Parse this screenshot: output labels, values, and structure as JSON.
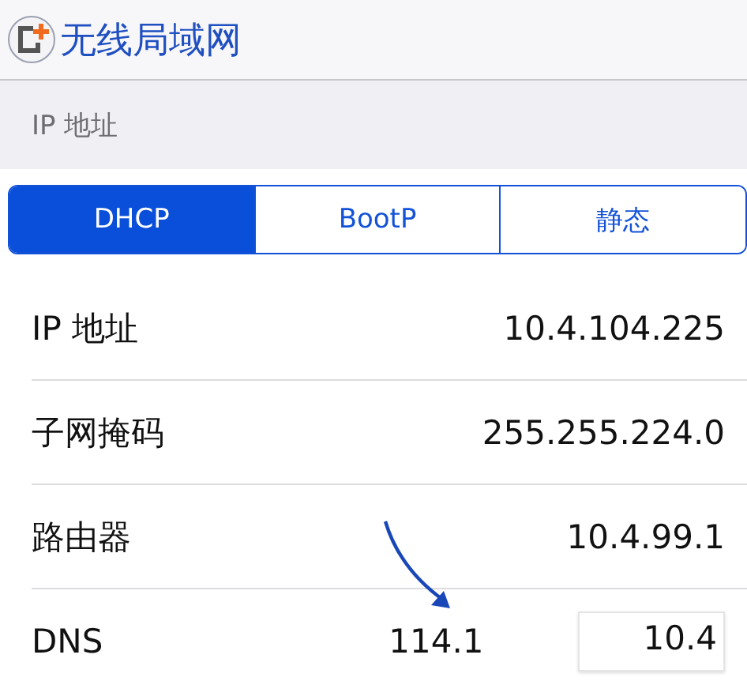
{
  "nav": {
    "title": "无线局域网"
  },
  "section_header": "IP 地址",
  "segments": [
    {
      "label": "DHCP",
      "selected": true
    },
    {
      "label": "BootP",
      "selected": false
    },
    {
      "label": "静态",
      "selected": false
    }
  ],
  "rows": [
    {
      "label": "IP 地址",
      "values": [
        "10.4.104.225"
      ]
    },
    {
      "label": "子网掩码",
      "values": [
        "255.255.224.0"
      ]
    },
    {
      "label": "路由器",
      "values": [
        "10.4.99.1"
      ]
    },
    {
      "label": "DNS",
      "values": [
        "114.1",
        "10.4"
      ]
    }
  ]
}
